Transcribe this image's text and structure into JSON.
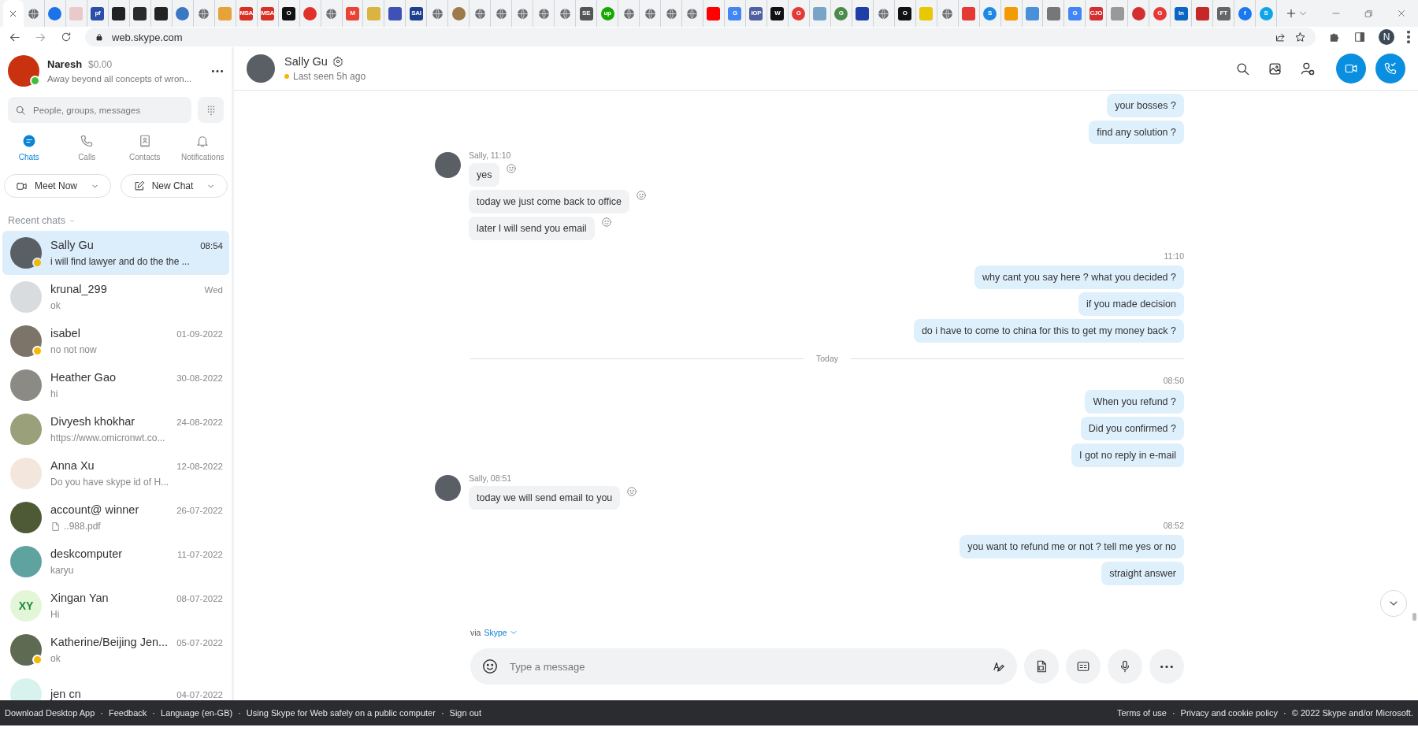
{
  "browser": {
    "tabs": [
      {
        "kind": "blank",
        "selected": true
      },
      {
        "kind": "globe",
        "selected": false
      },
      {
        "kind": "round",
        "color": "#1a73e8",
        "selected": false
      },
      {
        "kind": "logo",
        "color": "#e9c9c9",
        "selected": false
      },
      {
        "kind": "logo",
        "color": "#2b4fa8",
        "glyph": "pf",
        "selected": false
      },
      {
        "kind": "logo",
        "color": "#222222",
        "selected": false
      },
      {
        "kind": "logo",
        "color": "#2a2a2a",
        "selected": false
      },
      {
        "kind": "logo",
        "color": "#232323",
        "selected": false
      },
      {
        "kind": "round",
        "color": "#3b78c4",
        "selected": false
      },
      {
        "kind": "globe",
        "selected": false
      },
      {
        "kind": "logo",
        "color": "#e8a23a",
        "selected": false
      },
      {
        "kind": "logo",
        "color": "#d93025",
        "glyph": "MSA",
        "selected": false
      },
      {
        "kind": "logo",
        "color": "#d93026",
        "glyph": "MSA",
        "selected": false
      },
      {
        "kind": "logo",
        "color": "#111111",
        "glyph": "O",
        "selected": false
      },
      {
        "kind": "round",
        "color": "#e0322b",
        "selected": false
      },
      {
        "kind": "globe",
        "selected": false
      },
      {
        "kind": "logo",
        "color": "#ea4335",
        "glyph": "M",
        "selected": false
      },
      {
        "kind": "logo",
        "color": "#d9b440",
        "selected": false
      },
      {
        "kind": "logo",
        "color": "#3f51b5",
        "selected": false
      },
      {
        "kind": "logo",
        "color": "#1d3f8f",
        "glyph": "SAI",
        "selected": false
      },
      {
        "kind": "globe",
        "selected": false
      },
      {
        "kind": "round",
        "color": "#9c7a4a",
        "selected": false
      },
      {
        "kind": "globe",
        "selected": false
      },
      {
        "kind": "globe",
        "selected": false
      },
      {
        "kind": "globe",
        "selected": false
      },
      {
        "kind": "globe",
        "selected": false
      },
      {
        "kind": "globe",
        "selected": false
      },
      {
        "kind": "logo",
        "color": "#555555",
        "glyph": "SE",
        "selected": false
      },
      {
        "kind": "round",
        "color": "#14a800",
        "glyph": "up",
        "selected": false
      },
      {
        "kind": "globe",
        "selected": false
      },
      {
        "kind": "globe",
        "selected": false
      },
      {
        "kind": "globe",
        "selected": false
      },
      {
        "kind": "globe",
        "selected": false
      },
      {
        "kind": "logo",
        "color": "#ff0000",
        "selected": false
      },
      {
        "kind": "logo",
        "color": "#4285f4",
        "glyph": "G",
        "selected": false
      },
      {
        "kind": "logo",
        "color": "#5060a0",
        "glyph": "IOP",
        "selected": false
      },
      {
        "kind": "logo",
        "color": "#111112",
        "glyph": "W",
        "selected": false
      },
      {
        "kind": "round",
        "color": "#e53935",
        "glyph": "G",
        "selected": false
      },
      {
        "kind": "logo",
        "color": "#7aa3c8",
        "selected": false
      },
      {
        "kind": "round",
        "color": "#4a8a4a",
        "glyph": "G",
        "selected": false
      },
      {
        "kind": "logo",
        "color": "#1e3fa8",
        "selected": false
      },
      {
        "kind": "globe",
        "selected": false
      },
      {
        "kind": "logo",
        "color": "#121212",
        "glyph": "O",
        "selected": false
      },
      {
        "kind": "logo",
        "color": "#e8c800",
        "selected": false
      },
      {
        "kind": "globe",
        "selected": false
      },
      {
        "kind": "logo",
        "color": "#e53936",
        "selected": false
      },
      {
        "kind": "round",
        "color": "#1e88e5",
        "glyph": "S",
        "selected": false
      },
      {
        "kind": "logo",
        "color": "#f29b05",
        "selected": false
      },
      {
        "kind": "logo",
        "color": "#4a90d9",
        "selected": false
      },
      {
        "kind": "logo",
        "color": "#777777",
        "selected": false
      },
      {
        "kind": "logo",
        "color": "#4285f5",
        "glyph": "G",
        "selected": false
      },
      {
        "kind": "logo",
        "color": "#d32f2f",
        "glyph": "CJO",
        "selected": false
      },
      {
        "kind": "logo",
        "color": "#999999",
        "selected": false
      },
      {
        "kind": "round",
        "color": "#d32f30",
        "selected": false
      },
      {
        "kind": "round",
        "color": "#e53937",
        "glyph": "G",
        "selected": false
      },
      {
        "kind": "logo",
        "color": "#0a66c2",
        "glyph": "in",
        "selected": false
      },
      {
        "kind": "logo",
        "color": "#c62828",
        "selected": false
      },
      {
        "kind": "logo",
        "color": "#666666",
        "glyph": "FT",
        "selected": false
      },
      {
        "kind": "round",
        "color": "#1877f2",
        "glyph": "f",
        "selected": false
      },
      {
        "kind": "round",
        "color": "#0ea5e9",
        "glyph": "S",
        "selected": false
      }
    ],
    "address": "web.skype.com",
    "profile_initial": "N"
  },
  "profile": {
    "name": "Naresh",
    "balance": "$0.00",
    "mood": "Away beyond all concepts of wron...",
    "online": true,
    "avatar": {
      "kind": "photo",
      "color": "#c8320f"
    }
  },
  "search": {
    "placeholder": "People, groups, messages"
  },
  "nav": [
    {
      "label": "Chats",
      "selected": true
    },
    {
      "label": "Calls",
      "selected": false
    },
    {
      "label": "Contacts",
      "selected": false
    },
    {
      "label": "Notifications",
      "selected": false
    }
  ],
  "actions": [
    {
      "kind": "meet",
      "label": "Meet Now"
    },
    {
      "kind": "new",
      "label": "New Chat"
    }
  ],
  "recent_label": "Recent chats",
  "chats": [
    {
      "name": "Sally Gu",
      "preview": "i will find lawyer and do the the ...",
      "time": "08:54",
      "selected": true,
      "away": true,
      "avatar": {
        "kind": "photo",
        "color": "#5a5f66"
      }
    },
    {
      "name": "krunal_299",
      "preview": "ok",
      "time": "Wed",
      "selected": false,
      "away": false,
      "avatar": {
        "kind": "photo",
        "color": "#d9dcdf"
      }
    },
    {
      "name": "isabel",
      "preview": "no not now",
      "time": "01-09-2022",
      "selected": false,
      "away": true,
      "avatar": {
        "kind": "photo",
        "color": "#7c7468"
      }
    },
    {
      "name": "Heather Gao",
      "preview": "hi",
      "time": "30-08-2022",
      "selected": false,
      "away": false,
      "avatar": {
        "kind": "photo",
        "color": "#8b8a85"
      }
    },
    {
      "name": "Divyesh khokhar",
      "preview": "https://www.omicronwt.co...",
      "time": "24-08-2022",
      "selected": false,
      "away": false,
      "avatar": {
        "kind": "photo",
        "color": "#9aa07a"
      }
    },
    {
      "name": "Anna Xu",
      "preview": "Do you have skype id of H...",
      "time": "12-08-2022",
      "selected": false,
      "away": false,
      "avatar": {
        "kind": "photo",
        "color": "#f3e6dc"
      }
    },
    {
      "name": "account@ winner",
      "preview": "..988.pdf",
      "file": true,
      "time": "26-07-2022",
      "selected": false,
      "away": false,
      "avatar": {
        "kind": "photo",
        "color": "#4d5a35"
      }
    },
    {
      "name": "deskcomputer",
      "preview": "karyu",
      "time": "11-07-2022",
      "selected": false,
      "away": false,
      "avatar": {
        "kind": "photo",
        "color": "#5fa3a0"
      }
    },
    {
      "name": "Xingan  Yan",
      "preview": "Hi",
      "time": "08-07-2022",
      "selected": false,
      "away": false,
      "avatar": {
        "kind": "initials",
        "text": "XY"
      }
    },
    {
      "name": "Katherine/Beijing Jen...",
      "preview": "ok",
      "time": "05-07-2022",
      "selected": false,
      "away": true,
      "avatar": {
        "kind": "photo",
        "color": "#5e6b52"
      }
    },
    {
      "name": "jen cn",
      "time": "04-07-2022",
      "selected": false,
      "away": false,
      "avatar": {
        "kind": "photo",
        "color": "#d8f3ee"
      }
    }
  ],
  "conversation": {
    "name": "Sally Gu",
    "away": true,
    "last_seen": "Last seen 5h ago",
    "items": [
      {
        "kind": "outgoing",
        "messages": [
          "your bosses ?",
          "find any solution ?"
        ]
      },
      {
        "kind": "incoming",
        "label": "Sally, 11:10",
        "messages": [
          "yes",
          "today we just come back to office",
          "later I will send you email"
        ]
      },
      {
        "kind": "outgoing",
        "time": "11:10",
        "messages": [
          "why cant you say here ? what you decided ?",
          "if you made decision",
          "do i have to come to china for this  to get my money back ?"
        ]
      },
      {
        "kind": "divider",
        "label": "Today"
      },
      {
        "kind": "outgoing",
        "time": "08:50",
        "messages": [
          "When you refund ?",
          "Did you confirmed ?",
          "I got no reply in e-mail"
        ]
      },
      {
        "kind": "incoming",
        "label": "Sally, 08:51",
        "messages": [
          "today we will send email to you"
        ]
      },
      {
        "kind": "outgoing",
        "time": "08:52",
        "messages": [
          "you want to refund me or not ? tell me yes or no",
          "straight answer"
        ]
      }
    ],
    "via": "via",
    "via_link": "Skype",
    "composer_placeholder": "Type a message"
  },
  "footer": {
    "separator": "·",
    "left": [
      "Download Desktop App",
      "Feedback",
      "Language (en-GB)",
      "Using Skype for Web safely on a public computer",
      "Sign out"
    ],
    "right": [
      "Terms of use",
      "Privacy and cookie policy",
      "© 2022 Skype and/or Microsoft."
    ]
  }
}
